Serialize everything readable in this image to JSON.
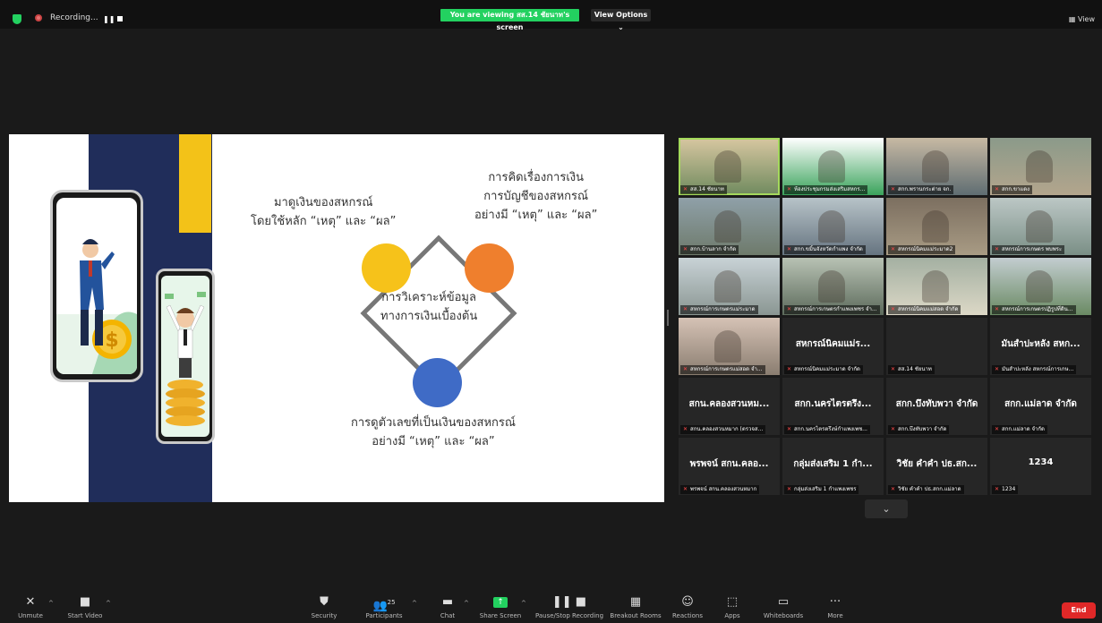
{
  "topbar": {
    "recording_label": "Recording...",
    "pause_icon": "pause-icon",
    "viewing_banner": "You are viewing สส.14 ชัยนาท's screen",
    "view_options": "View Options ⌄",
    "view_label": "View"
  },
  "slide": {
    "top_left": [
      "มาดูเงินของสหกรณ์",
      "โดยใช้หลัก “เหตุ” และ “ผล”"
    ],
    "top_right": [
      "การคิดเรื่องการเงิน",
      "การบัญชีของสหกรณ์",
      "อย่างมี “เหตุ” และ “ผล”"
    ],
    "center": [
      "การวิเคราะห์ข้อมูล",
      "ทางการเงินเบื้องต้น"
    ],
    "bottom": [
      "การดูตัวเลขที่เป็นเงินของสหกรณ์",
      "อย่างมี “เหตุ” และ “ผล”"
    ],
    "colors": {
      "navy": "#202d5a",
      "gold": "#f3c218",
      "yellow": "#f6c21a",
      "orange": "#ef7f2d",
      "blue": "#3f6bc6"
    }
  },
  "grid": {
    "tiles": [
      {
        "name": "สส.14 ชัยนาท",
        "video": true
      },
      {
        "name": "ห้องประชุมกรมส่งเสริมสหกร...",
        "video": true
      },
      {
        "name": "สกก.พรานกระต่าย จก.",
        "video": true
      },
      {
        "name": "สกก.ขาแดง",
        "video": true
      },
      {
        "name": "สกก.บ้านลาก จำกัด",
        "video": true
      },
      {
        "name": "สกก.ขมิ้นจังหวัดกำแพง จำกัด",
        "video": true
      },
      {
        "name": "สหกรณ์นิคมแม่ระมาด2",
        "video": true
      },
      {
        "name": "สหกรณ์การเกษตร พบพระ",
        "video": true
      },
      {
        "name": "สหกรณ์การเกษตรแม่ระมาด",
        "video": true
      },
      {
        "name": "สหกรณ์การเกษตรกำแพงเพชร จำ...",
        "video": true
      },
      {
        "name": "สหกรณ์นิคมแม่สอด จำกัด",
        "video": true
      },
      {
        "name": "สหกรณ์การเกษตรปฏิรูปที่ดิน...",
        "video": true
      },
      {
        "name": "สหกรณ์การเกษตรแม่สอด จำ...",
        "video": true
      },
      {
        "name": "สหกรณ์นิคมแม่ระมาด จำกัด",
        "title": "สหกรณ์นิคมแม่ร...",
        "video": false
      },
      {
        "name": "สส.14 ชัยนาท",
        "video": false
      },
      {
        "name": "มันสำปะหลัง สหกรณ์การเกษ...",
        "title": "มันสำปะหลัง สหก...",
        "video": false
      },
      {
        "name": "สกน.คลองสวนหมาก (ตรวจส...",
        "title": "สกน.คลองสวนหม...",
        "video": false
      },
      {
        "name": "สกก.นครไตรตรึงษ์กำแพงเพช...",
        "title": "สกก.นครไตรตรึง...",
        "video": false
      },
      {
        "name": "สกก.บึงทับพวา จำกัด",
        "title": "สกก.บึงทับพวา จำกัด",
        "video": false
      },
      {
        "name": "สกก.แม่ลาด จำกัด",
        "title": "สกก.แม่ลาด จำกัด",
        "video": false
      },
      {
        "name": "พรพจน์ สกน.คลองสวนหมาก",
        "title": "พรพจน์ สกน.คลอ...",
        "video": false
      },
      {
        "name": "กลุ่มส่งเสริม 1 กำแพงเพชร",
        "title": "กลุ่มส่งเสริม 1 กำ...",
        "video": false
      },
      {
        "name": "วิชัย คำคำ ปธ.สกก.แม่ลาด",
        "title": "วิชัย คำคำ ปธ.สก...",
        "video": false
      },
      {
        "name": "1234",
        "title": "1234",
        "video": false
      }
    ]
  },
  "toolbar": {
    "unmute": "Unmute",
    "start_video": "Start Video",
    "security": "Security",
    "participants": "Participants",
    "participants_count": "25",
    "chat": "Chat",
    "share_screen": "Share Screen",
    "pause_stop_recording": "Pause/Stop Recording",
    "breakout_rooms": "Breakout Rooms",
    "reactions": "Reactions",
    "apps": "Apps",
    "whiteboards": "Whiteboards",
    "more": "More",
    "end": "End"
  }
}
